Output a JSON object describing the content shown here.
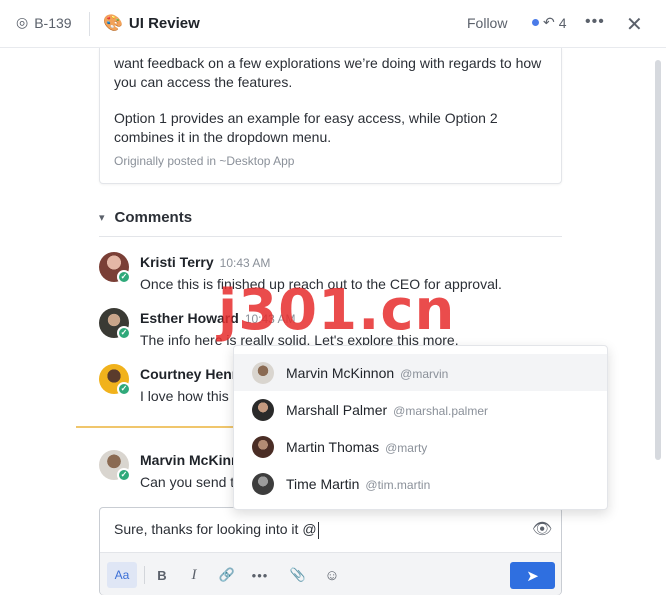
{
  "header": {
    "ticket_id": "B-139",
    "title": "UI Review",
    "follow_label": "Follow",
    "reply_count": "4"
  },
  "description": {
    "paragraph1": "want feedback on a few explorations we’re doing with regards to how you can access the features.",
    "paragraph2": "Option 1 provides an example for easy access, while Option 2 combines it in the dropdown menu.",
    "posted_in": "Originally posted in ~Desktop App"
  },
  "comments_section": {
    "title": "Comments",
    "items": [
      {
        "name": "Kristi Terry",
        "time": "10:43 AM",
        "text": "Once this is finished up reach out to the CEO for approval."
      },
      {
        "name": "Esther Howard",
        "time": "10:43 AM",
        "text": "The info here is really solid. Let's explore this more."
      },
      {
        "name": "Courtney Henr",
        "time": "",
        "text": "I love how this i"
      },
      {
        "name": "Marvin McKinn",
        "time": "",
        "text": "Can you send th"
      }
    ]
  },
  "mention_dropdown": {
    "items": [
      {
        "name": "Marvin McKinnon",
        "handle": "@marvin"
      },
      {
        "name": "Marshall Palmer",
        "handle": "@marshal.palmer"
      },
      {
        "name": "Martin Thomas",
        "handle": "@marty"
      },
      {
        "name": "Time Martin",
        "handle": "@tim.martin"
      }
    ]
  },
  "composer": {
    "text": "Sure, thanks for looking into it @",
    "format_label": "Aa"
  },
  "watermark": "j301.cn",
  "colors": {
    "accent": "#2f6fe0",
    "online": "#2fa97a",
    "new_divider": "#f0c66c"
  }
}
